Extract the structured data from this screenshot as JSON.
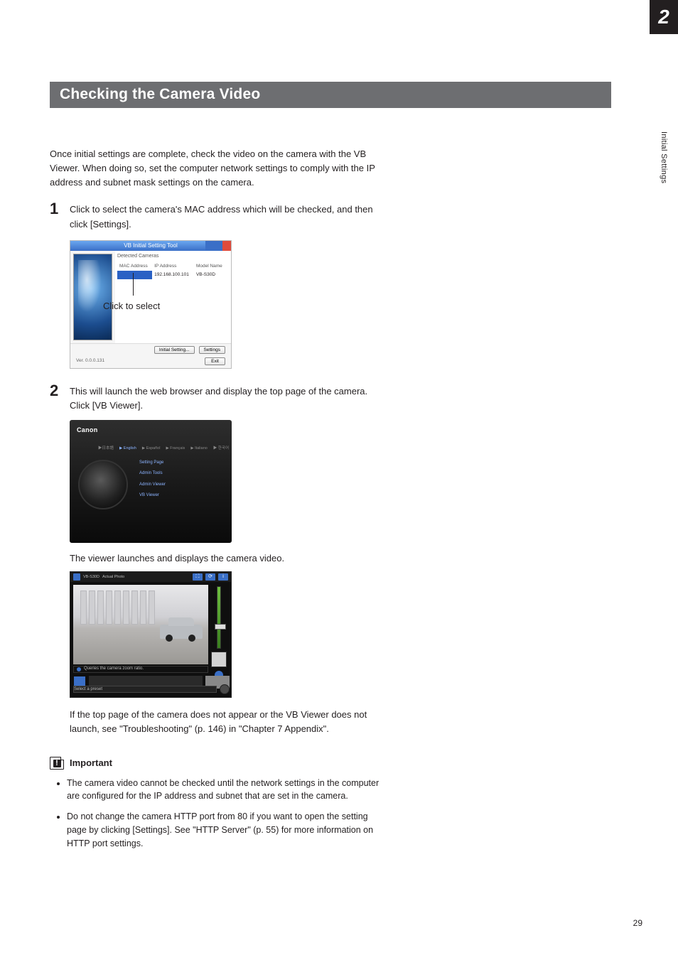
{
  "chapter_number": "2",
  "side_label": "Initial Settings",
  "page_number": "29",
  "title": "Checking the Camera Video",
  "intro": "Once initial settings are complete, check the video on the camera with the VB Viewer. When doing so, set the computer network settings to comply with the IP address and subnet mask settings on the camera.",
  "step1": {
    "num": "1",
    "text": "Click to select the camera's MAC address which will be checked, and then click [Settings]."
  },
  "fig1": {
    "window_title": "VB Initial Setting Tool",
    "group_label": "Detected Cameras",
    "cols": {
      "mac": "MAC Address",
      "ip": "IP Address",
      "model": "Model Name"
    },
    "row": {
      "ip": "192.168.100.101",
      "model": "VB-S30D"
    },
    "click_label": "Click to select",
    "btn_initial": "Initial Setting...",
    "btn_settings": "Settings",
    "version": "Ver. 0.0.0.131",
    "btn_exit": "Exit"
  },
  "step2": {
    "num": "2",
    "text": "This will launch the web browser and display the top page of the camera. Click [VB Viewer]."
  },
  "fig2": {
    "logo": "Canon",
    "langs": [
      "▶日本語",
      "▶ English",
      "▶ Español",
      "▶ Français",
      "▶ Italiano",
      "▶ 한국어"
    ],
    "links": [
      "Setting Page",
      "Admin Tools",
      "Admin Viewer",
      "VB Viewer"
    ]
  },
  "figcap": "The viewer launches and displays the camera video.",
  "fig3": {
    "id_text": "VB-S30D",
    "mode": "Actual Photo",
    "status": "Queries the camera zoom ratio.",
    "preset": "Select a preset"
  },
  "troubleshoot": "If the top page of the camera does not appear or the VB Viewer does not launch, see \"Troubleshooting\" (p. 146) in \"Chapter 7 Appendix\".",
  "important": {
    "heading": "Important",
    "bullets": [
      "The camera video cannot be checked until the network settings in the computer are configured for the IP address and subnet that are set in the camera.",
      "Do not change the camera HTTP port from 80 if you want to open the setting page by clicking [Settings]. See \"HTTP Server\" (p. 55) for more information on HTTP port settings."
    ]
  }
}
